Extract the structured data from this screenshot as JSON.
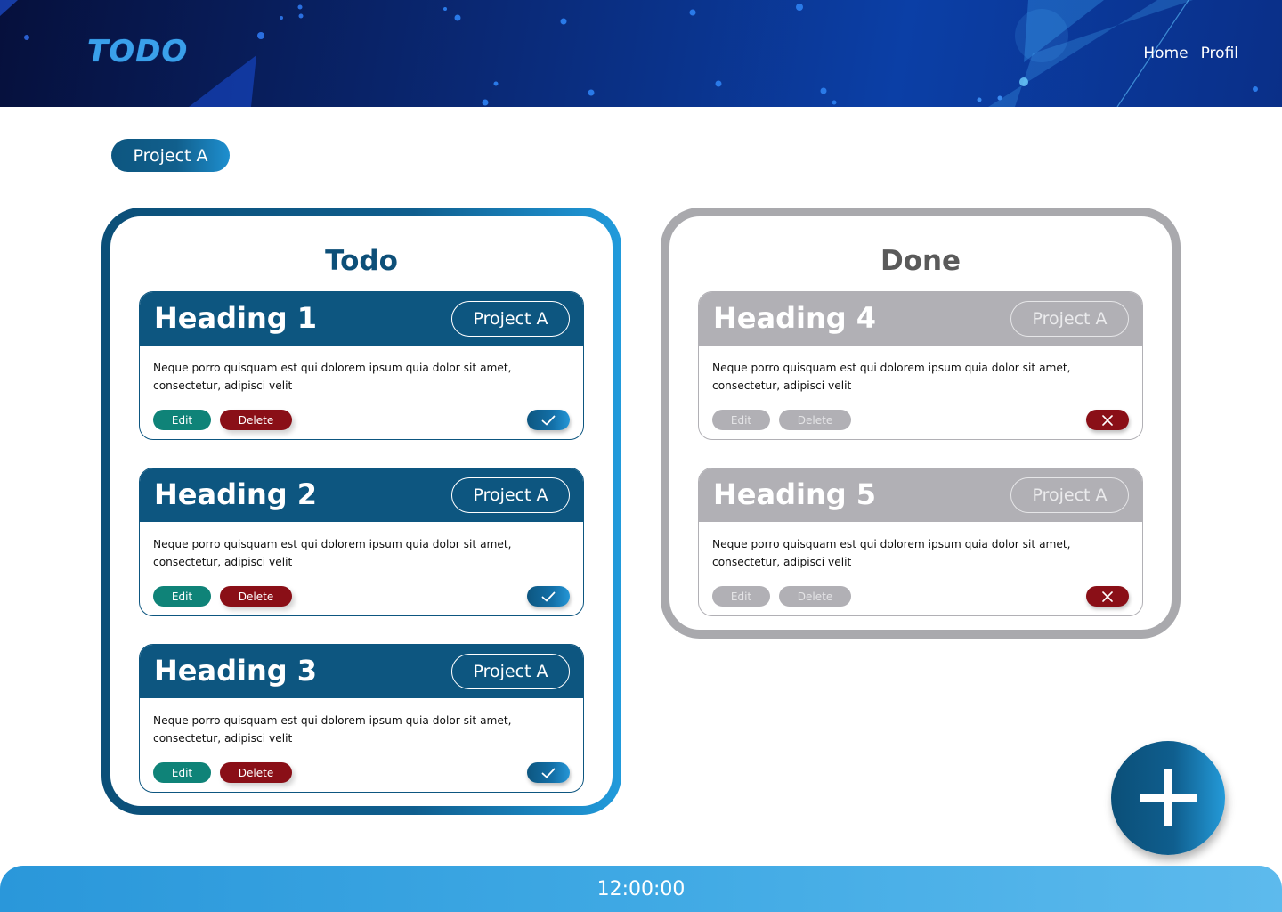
{
  "header": {
    "logo": "TODO",
    "nav": [
      "Home",
      "Profil"
    ]
  },
  "project_filter": "Project A",
  "columns": {
    "todo": {
      "title": "Todo",
      "cards": [
        {
          "heading": "Heading 1",
          "project": "Project A",
          "text": "Neque porro quisquam est qui dolorem ipsum quia dolor sit amet, consectetur, adipisci velit",
          "edit": "Edit",
          "delete": "Delete"
        },
        {
          "heading": "Heading 2",
          "project": "Project A",
          "text": "Neque porro quisquam est qui dolorem ipsum quia dolor sit amet, consectetur, adipisci velit",
          "edit": "Edit",
          "delete": "Delete"
        },
        {
          "heading": "Heading 3",
          "project": "Project A",
          "text": "Neque porro quisquam est qui dolorem ipsum quia dolor sit amet, consectetur, adipisci velit",
          "edit": "Edit",
          "delete": "Delete"
        }
      ]
    },
    "done": {
      "title": "Done",
      "cards": [
        {
          "heading": "Heading 4",
          "project": "Project A",
          "text": "Neque porro quisquam est qui dolorem ipsum quia dolor sit amet, consectetur, adipisci velit",
          "edit": "Edit",
          "delete": "Delete"
        },
        {
          "heading": "Heading 5",
          "project": "Project A",
          "text": "Neque porro quisquam est qui dolorem ipsum quia dolor sit amet, consectetur, adipisci velit",
          "edit": "Edit",
          "delete": "Delete"
        }
      ]
    }
  },
  "footer": {
    "clock": "12:00:00"
  },
  "icons": {
    "todo_status": "check-icon",
    "done_status": "close-icon",
    "fab": "plus-icon"
  },
  "colors": {
    "primary": "#0d5680",
    "accent": "#249ad8",
    "edit": "#0f8378",
    "delete": "#8a0f17",
    "muted": "#b1b0b5"
  }
}
